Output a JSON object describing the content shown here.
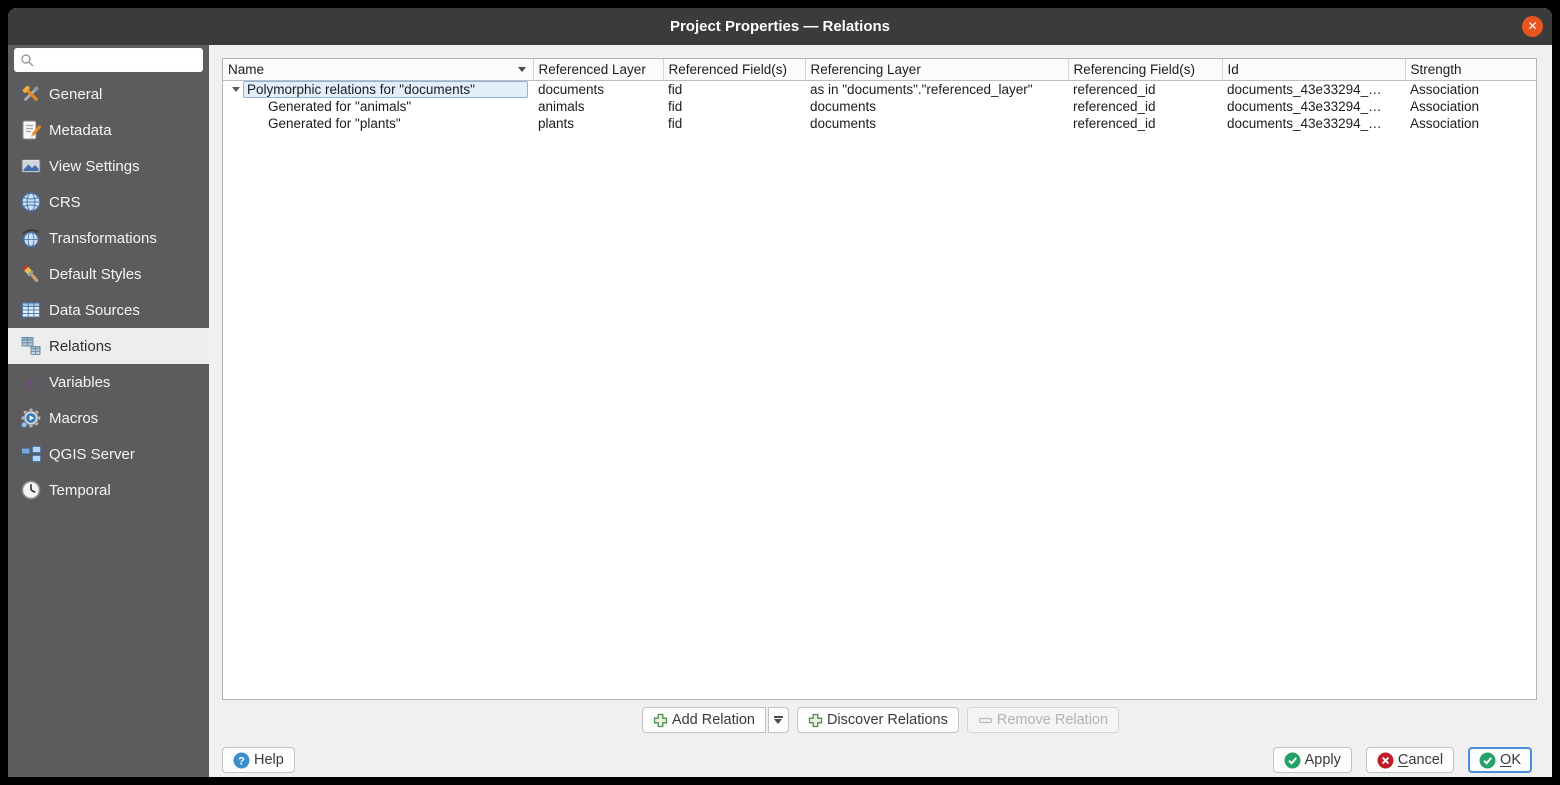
{
  "window": {
    "title": "Project Properties — Relations",
    "close_glyph": "✕"
  },
  "sidebar": {
    "search_value": "",
    "items": [
      {
        "label": "General",
        "icon": "tools-icon",
        "selected": false
      },
      {
        "label": "Metadata",
        "icon": "metadata-icon",
        "selected": false
      },
      {
        "label": "View Settings",
        "icon": "view-settings-icon",
        "selected": false
      },
      {
        "label": "CRS",
        "icon": "globe-icon",
        "selected": false
      },
      {
        "label": "Transformations",
        "icon": "globe-arrows-icon",
        "selected": false
      },
      {
        "label": "Default Styles",
        "icon": "paintbrush-icon",
        "selected": false
      },
      {
        "label": "Data Sources",
        "icon": "table-icon",
        "selected": false
      },
      {
        "label": "Relations",
        "icon": "relations-icon",
        "selected": true
      },
      {
        "label": "Variables",
        "icon": "epsilon-icon",
        "selected": false
      },
      {
        "label": "Macros",
        "icon": "gear-icon",
        "selected": false
      },
      {
        "label": "QGIS Server",
        "icon": "server-icon",
        "selected": false
      },
      {
        "label": "Temporal",
        "icon": "clock-icon",
        "selected": false
      }
    ]
  },
  "table": {
    "columns": [
      "Name",
      "Referenced Layer",
      "Referenced Field(s)",
      "Referencing Layer",
      "Referencing Field(s)",
      "Id",
      "Strength"
    ],
    "sort_column": "Name",
    "rows": [
      {
        "name": "Polymorphic relations for \"documents\"",
        "referenced_layer": "documents",
        "referenced_fields": "fid",
        "referencing_layer": "as in \"documents\".\"referenced_layer\"",
        "referencing_fields": "referenced_id",
        "id": "documents_43e33294_…",
        "strength": "Association",
        "expanded": true,
        "level": 0,
        "selected": true
      },
      {
        "name": "Generated for \"animals\"",
        "referenced_layer": "animals",
        "referenced_fields": "fid",
        "referencing_layer": "documents",
        "referencing_fields": "referenced_id",
        "id": "documents_43e33294_…",
        "strength": "Association",
        "level": 1,
        "selected": false
      },
      {
        "name": "Generated for \"plants\"",
        "referenced_layer": "plants",
        "referenced_fields": "fid",
        "referencing_layer": "documents",
        "referencing_fields": "referenced_id",
        "id": "documents_43e33294_…",
        "strength": "Association",
        "level": 1,
        "selected": false
      }
    ]
  },
  "actions": {
    "add_relation": "Add Relation",
    "discover_relations": "Discover Relations",
    "remove_relation": "Remove Relation",
    "remove_relation_enabled": false
  },
  "footer": {
    "help": "Help",
    "apply": "Apply",
    "cancel_mnemonic": "C",
    "cancel_rest": "ancel",
    "ok_mnemonic": "O",
    "ok_rest": "K"
  },
  "colors": {
    "titlebar": "#3b3b3b",
    "close_button": "#e9541f",
    "sidebar": "#5c5c5e",
    "selection_fill": "#e3eefb",
    "selection_border": "#8cb2dd",
    "focus_accent": "#4a90d9",
    "success_green": "#26a269",
    "danger_red": "#c01c28",
    "help_blue": "#3f8ecc",
    "add_green": "#4e8f4e"
  }
}
